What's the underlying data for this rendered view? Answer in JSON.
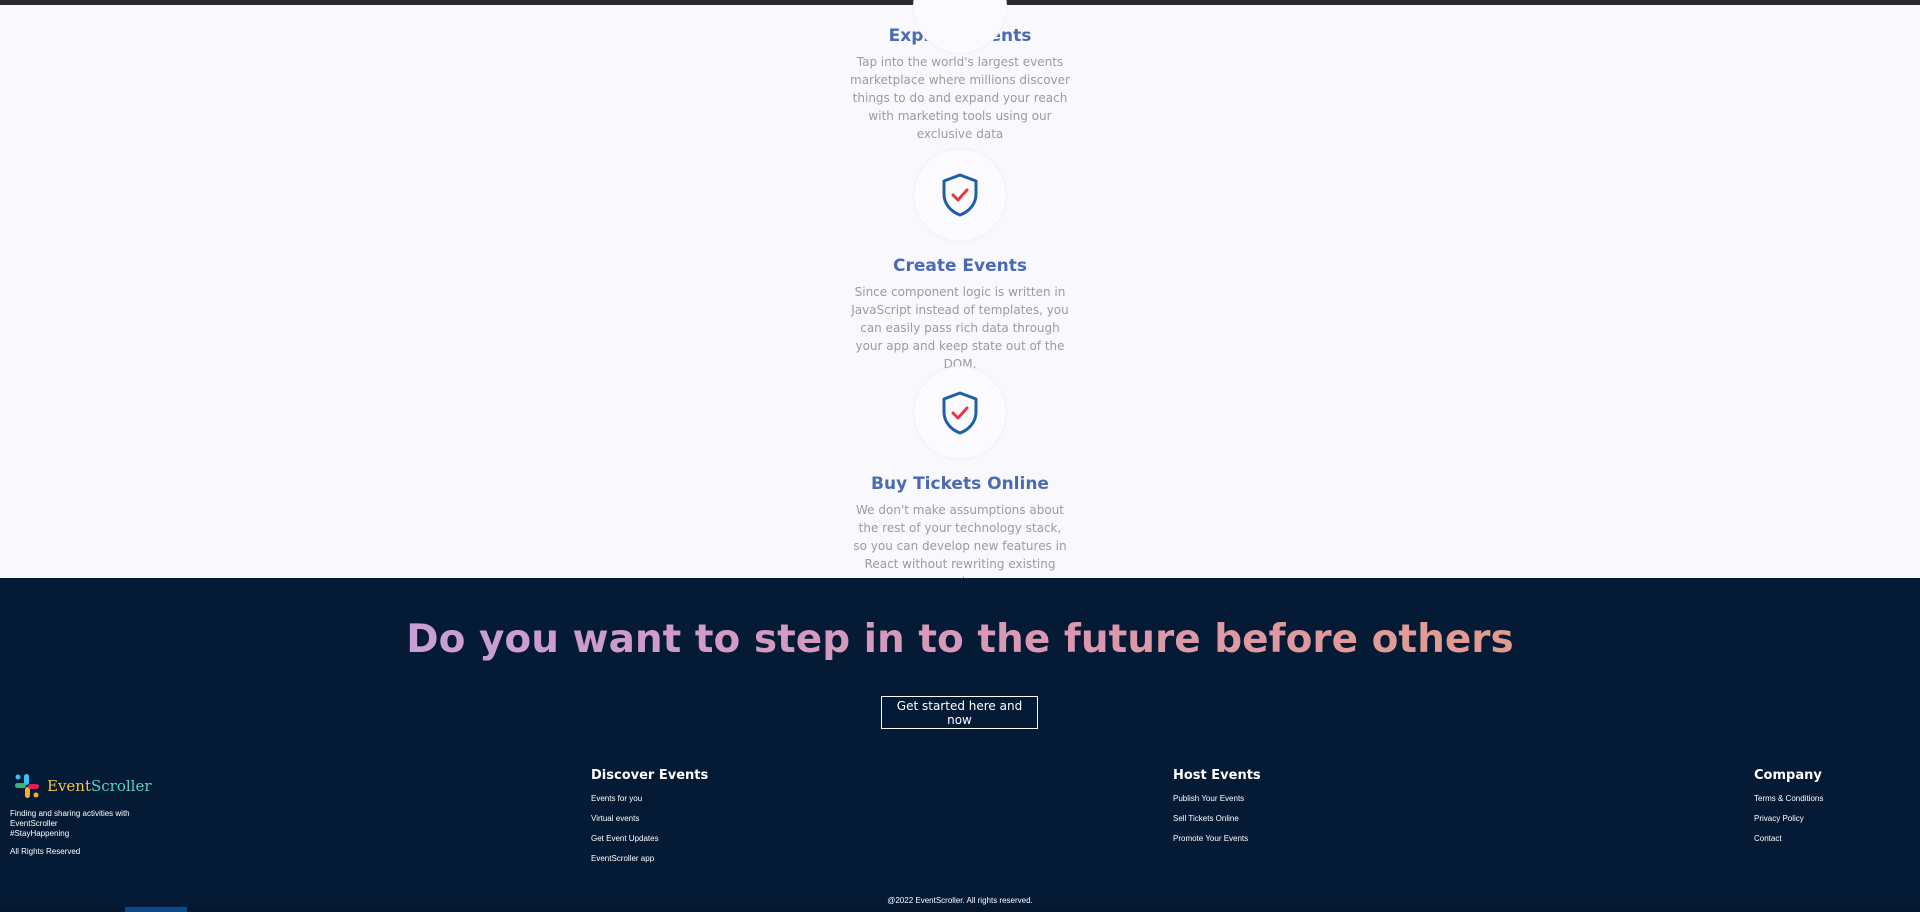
{
  "features": [
    {
      "title": "Explore Events",
      "description": "Tap into the world's largest events marketplace where millions discover things to do and expand your reach with marketing tools using our exclusive data",
      "icon": "shield-check-icon"
    },
    {
      "title": "Create Events",
      "description": "Since component logic is written in JavaScript instead of templates, you can easily pass rich data through your app and keep state out of the DOM.",
      "icon": "shield-check-icon"
    },
    {
      "title": "Buy Tickets Online",
      "description": "We don't make assumptions about the rest of your technology stack, so you can develop new features in React without rewriting existing code.",
      "icon": "shield-check-icon"
    }
  ],
  "cta": {
    "title": "Do you want to step in to the future before others",
    "button_label": "Get started here and now"
  },
  "footer": {
    "brand": {
      "name_part1": "Event",
      "name_part2": "Scroller",
      "logo_icon": "slack-style-logo-icon"
    },
    "tagline": "Finding and sharing activities with EventScroller",
    "hashtag": "#StayHappening",
    "rights": "All Rights Reserved",
    "columns": [
      {
        "title": "Discover Events",
        "links": [
          "Events for you",
          "Virtual events",
          "Get Event Updates",
          "EventScroller app"
        ]
      },
      {
        "title": "Host Events",
        "links": [
          "Publish Your Events",
          "Sell Tickets Online",
          "Promote Your Events"
        ]
      },
      {
        "title": "Company",
        "links": [
          "Terms & Conditions",
          "Privacy Policy",
          "Contact"
        ]
      }
    ],
    "copyright": "@2022 EventScroller. All rights reserved."
  },
  "colors": {
    "feature_title": "#4a6bb3",
    "footer_bg": "#041a35",
    "shield_stroke": "#1f5ea8",
    "check_mark": "#e03a3a"
  }
}
